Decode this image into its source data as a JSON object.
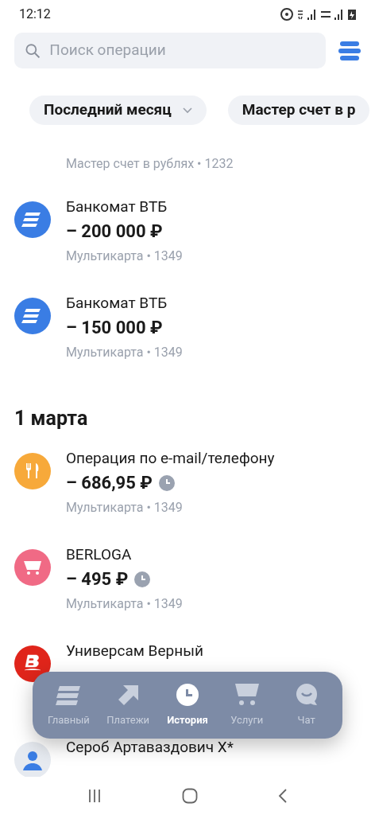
{
  "status_bar": {
    "time": "12:12"
  },
  "search": {
    "placeholder": "Поиск операции"
  },
  "filters": [
    {
      "label": "Последний месяц",
      "dropdown": true
    },
    {
      "label": "Мастер счет в р",
      "dropdown": false
    }
  ],
  "groups": [
    {
      "header": "Мастер счет в рублях • 1232",
      "kind": "account",
      "operations": [
        {
          "kind": "bank",
          "title": "Банкомат ВТБ",
          "amount": "– 200 000 ₽",
          "pending": false,
          "source": "Мультикарта • 1349"
        },
        {
          "kind": "bank",
          "title": "Банкомат ВТБ",
          "amount": "– 150 000 ₽",
          "pending": false,
          "source": "Мультикарта • 1349"
        }
      ]
    },
    {
      "header": "1 марта",
      "kind": "date",
      "operations": [
        {
          "kind": "food",
          "title": "Операция по e-mail/телефону",
          "amount": "– 686,95 ₽",
          "pending": true,
          "source": "Мультикарта • 1349"
        },
        {
          "kind": "shop",
          "title": "BERLOGA",
          "amount": "– 495 ₽",
          "pending": true,
          "source": "Мультикарта • 1349"
        },
        {
          "kind": "store",
          "title": "Универсам Верный"
        },
        {
          "kind": "person",
          "title": "Сероб Артаваздович Х*"
        }
      ]
    }
  ],
  "tab_bar": [
    {
      "kind": "home",
      "label": "Главный",
      "selected": false
    },
    {
      "kind": "pay",
      "label": "Платежи",
      "selected": false
    },
    {
      "kind": "history",
      "label": "История",
      "selected": true
    },
    {
      "kind": "services",
      "label": "Услуги",
      "selected": false
    },
    {
      "kind": "chat",
      "label": "Чат",
      "selected": false
    }
  ]
}
